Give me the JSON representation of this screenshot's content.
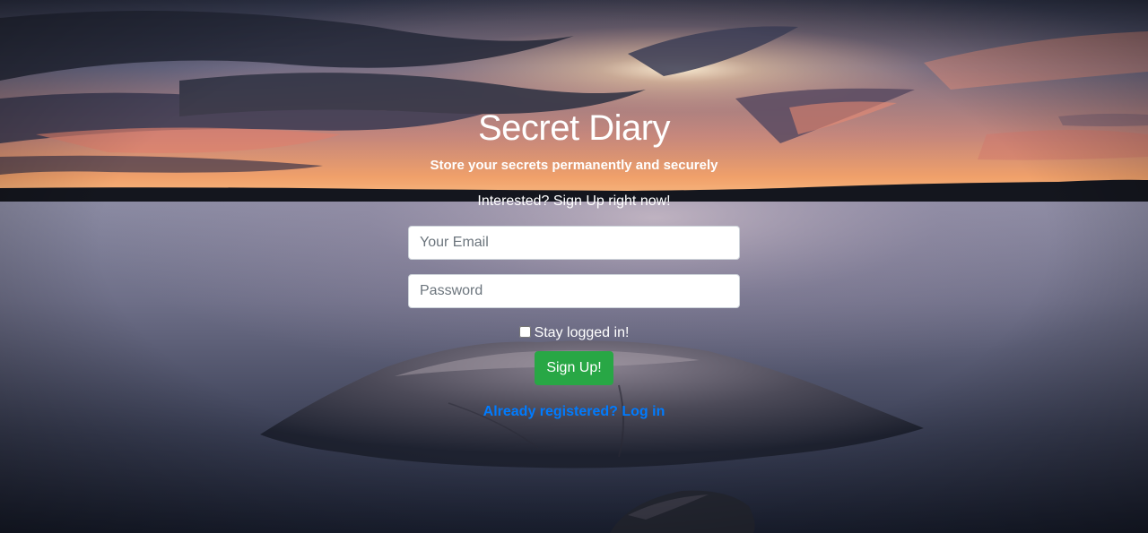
{
  "page": {
    "title": "Secret Diary",
    "tagline": "Store your secrets permanently and securely",
    "prompt": "Interested? Sign Up right now!"
  },
  "form": {
    "email_placeholder": "Your Email",
    "password_placeholder": "Password",
    "stay_logged_in_label": "Stay logged in!",
    "stay_logged_in_checked": false,
    "submit_label": "Sign Up!",
    "switch_link_label": "Already registered? Log in"
  },
  "colors": {
    "submit_button": "#28a745",
    "link": "#007bff",
    "text": "#ffffff"
  }
}
